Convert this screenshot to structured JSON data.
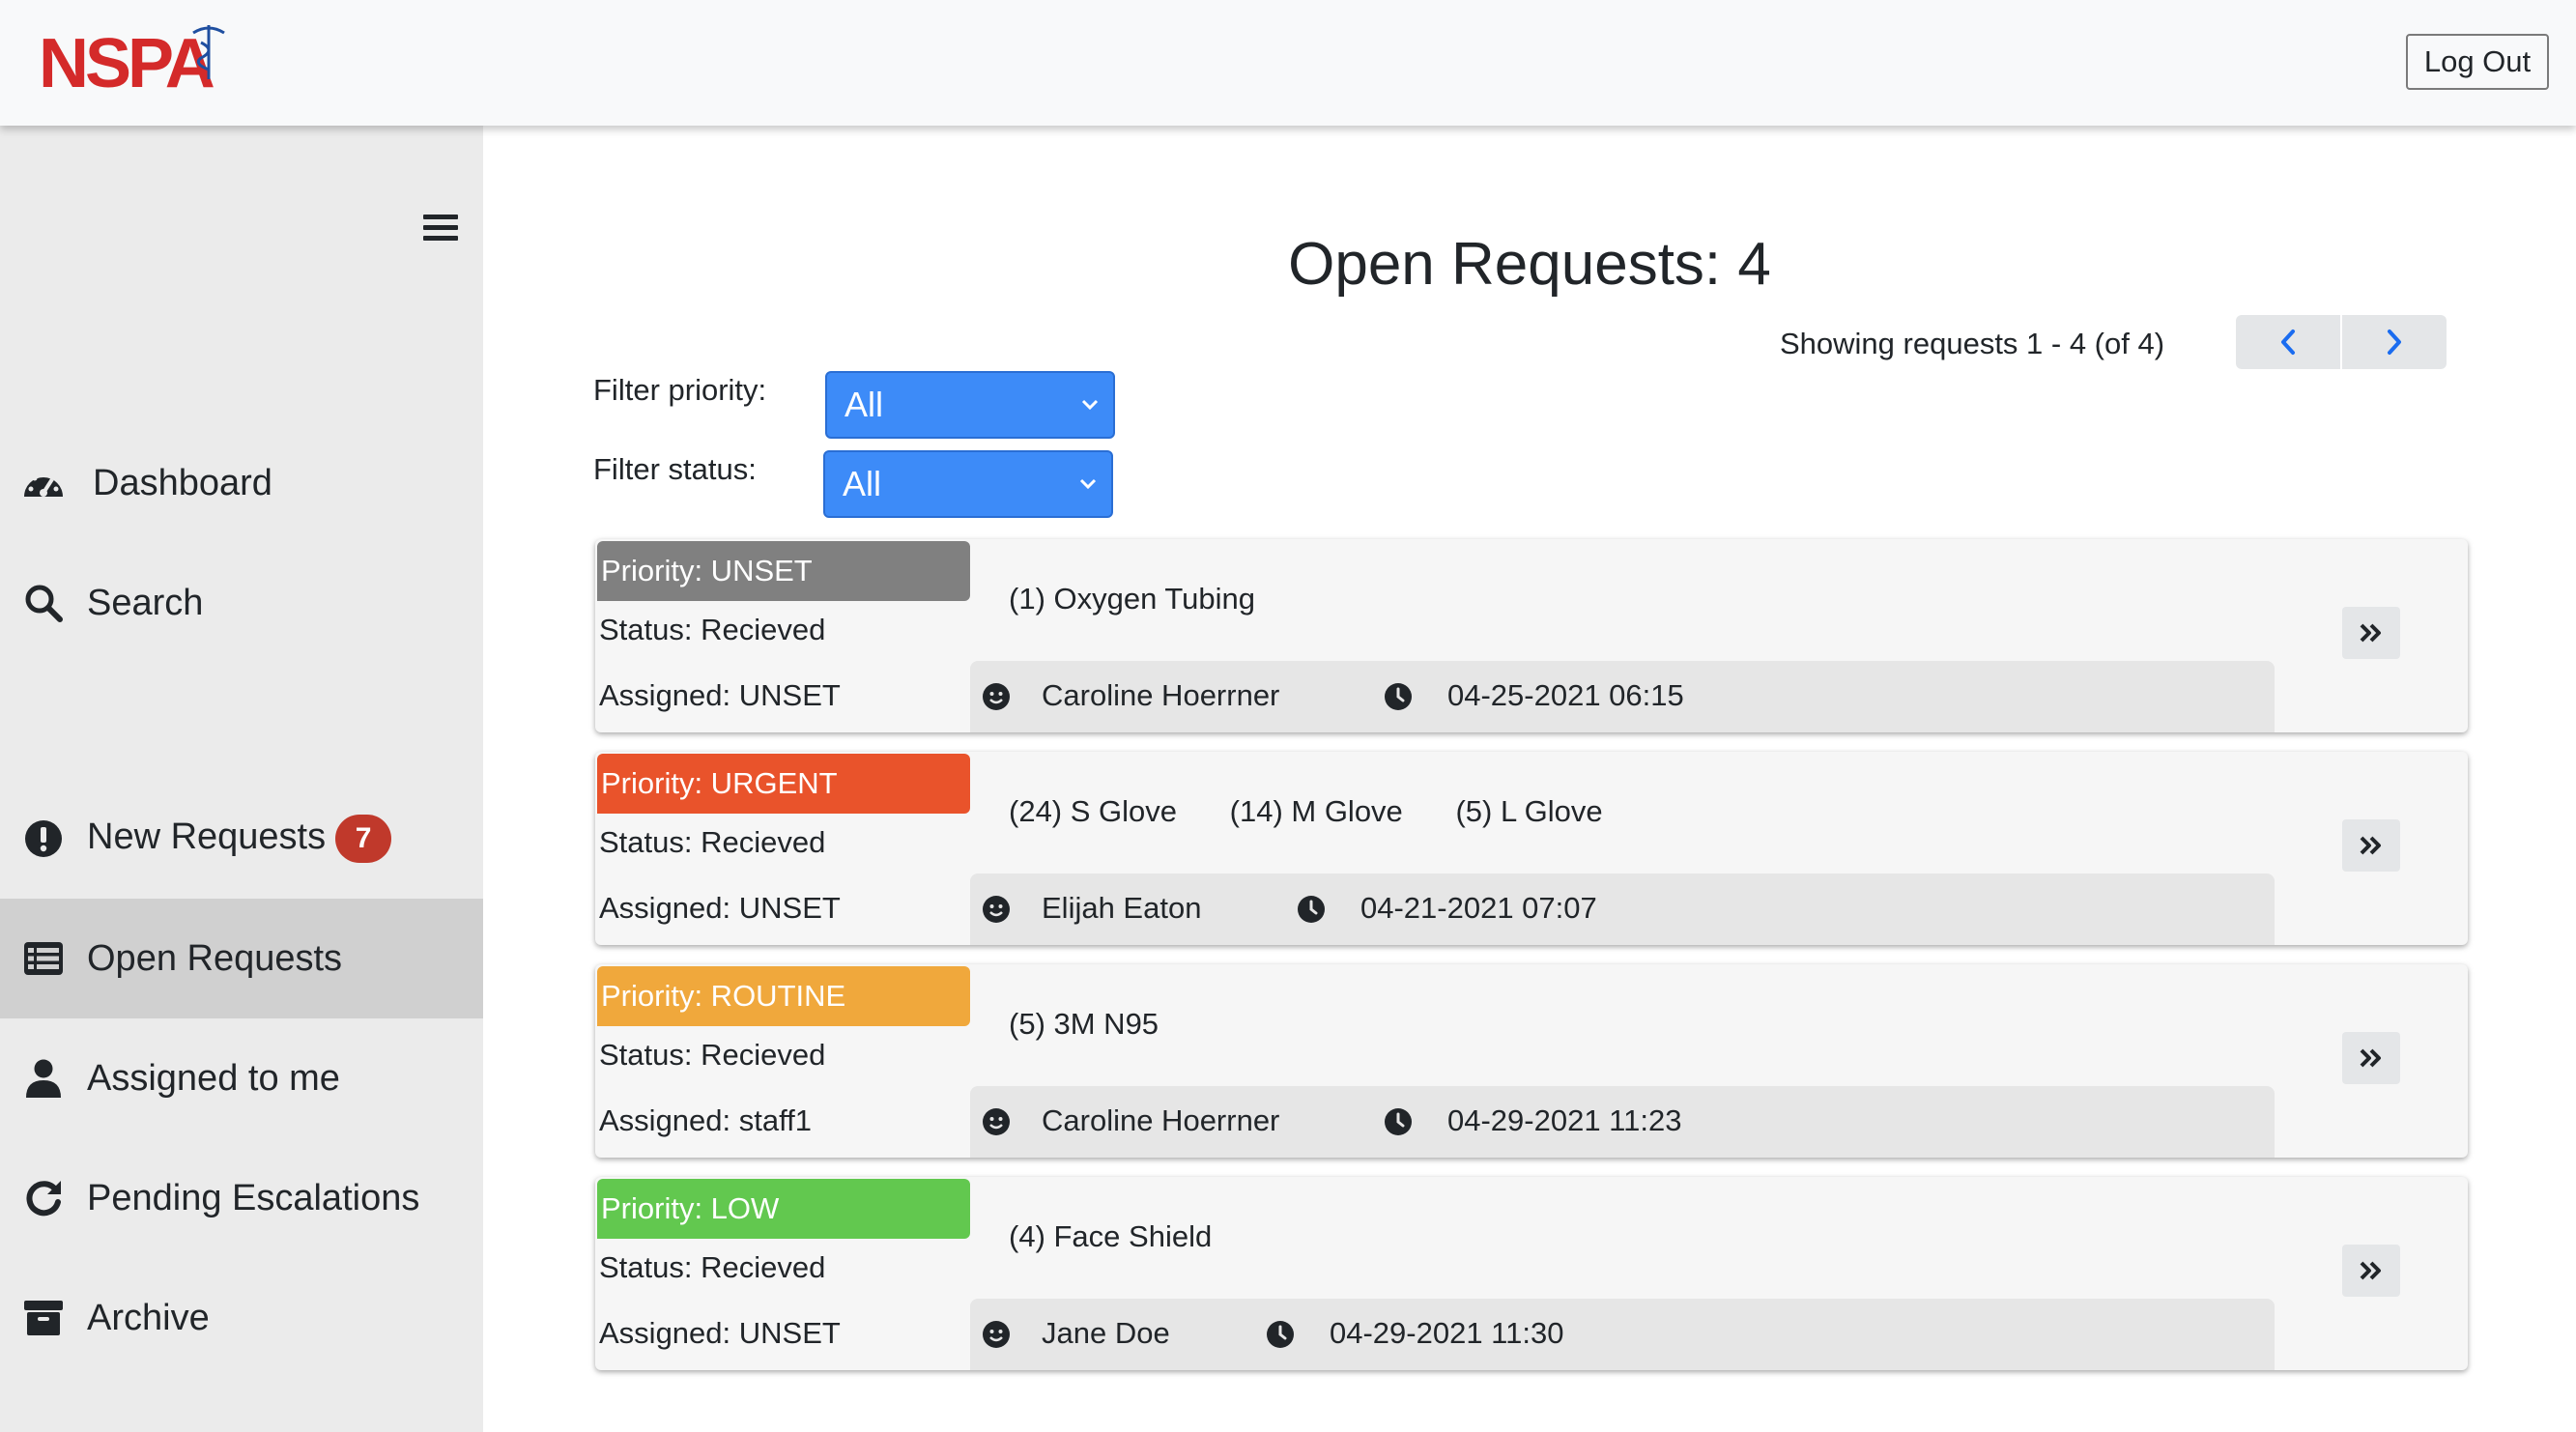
{
  "header": {
    "logo_text": "NSPA",
    "logout_label": "Log Out"
  },
  "sidebar": {
    "items": [
      {
        "label": "Dashboard",
        "icon": "dashboard-icon"
      },
      {
        "label": "Search",
        "icon": "search-icon"
      },
      {
        "label": "New Requests",
        "icon": "exclamation-icon",
        "badge": "7"
      },
      {
        "label": "Open Requests",
        "icon": "list-icon",
        "active": true
      },
      {
        "label": "Assigned to me",
        "icon": "user-icon"
      },
      {
        "label": "Pending Escalations",
        "icon": "redo-icon"
      },
      {
        "label": "Archive",
        "icon": "archive-icon"
      }
    ]
  },
  "main": {
    "title": "Open Requests: 4",
    "showing": "Showing requests 1 - 4 (of 4)",
    "filters": {
      "priority_label": "Filter priority:",
      "priority_value": "All",
      "status_label": "Filter status:",
      "status_value": "All"
    },
    "requests": [
      {
        "priority": "Priority: UNSET",
        "priority_color": "#808080",
        "status": "Status: Recieved",
        "assigned": "Assigned: UNSET",
        "items": [
          "(1) Oxygen Tubing"
        ],
        "requester": "Caroline Hoerrner",
        "datetime": "04-25-2021 06:15"
      },
      {
        "priority": "Priority: URGENT",
        "priority_color": "#e9532b",
        "status": "Status: Recieved",
        "assigned": "Assigned: UNSET",
        "items": [
          "(24) S Glove",
          "(14) M Glove",
          "(5) L Glove"
        ],
        "requester": "Elijah Eaton",
        "datetime": "04-21-2021 07:07"
      },
      {
        "priority": "Priority: ROUTINE",
        "priority_color": "#f0a83c",
        "status": "Status: Recieved",
        "assigned": "Assigned: staff1",
        "items": [
          "(5) 3M N95"
        ],
        "requester": "Caroline Hoerrner",
        "datetime": "04-29-2021 11:23"
      },
      {
        "priority": "Priority: LOW",
        "priority_color": "#62c84f",
        "status": "Status: Recieved",
        "assigned": "Assigned: UNSET",
        "items": [
          "(4) Face Shield"
        ],
        "requester": "Jane Doe",
        "datetime": "04-29-2021 11:30"
      }
    ]
  },
  "colors": {
    "accent_blue": "#3d8bf8",
    "badge_red": "#c0392b",
    "logo_red": "#d42a2a",
    "logo_blue": "#1f4fa0"
  }
}
